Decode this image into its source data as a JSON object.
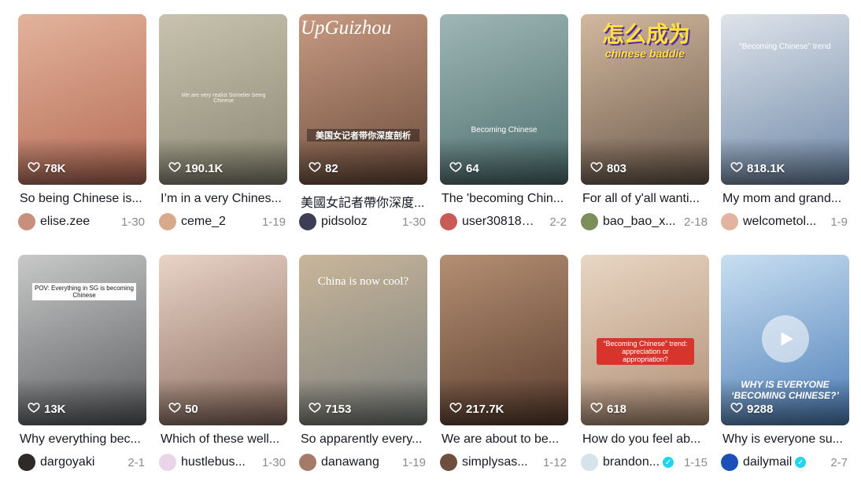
{
  "cards": [
    {
      "likes": "78K",
      "caption": "So being Chinese is...",
      "username": "elise.zee",
      "date": "1-30",
      "overlay": "",
      "bg": "#b46a55",
      "bg2": "#e3b39b",
      "avatar": "#c98f7d",
      "verified": false
    },
    {
      "likes": "190.1K",
      "caption": "I’m in a very Chines...",
      "username": "ceme_2",
      "date": "1-19",
      "overlay": "We are very realist Somelier being Chinese",
      "bg": "#8a8774",
      "bg2": "#c9c3ae",
      "avatar": "#d9a98c",
      "verified": false
    },
    {
      "likes": "82",
      "caption": "美國女記者帶你深度...",
      "username": "pidsoloz",
      "date": "1-30",
      "overlay": "UpGuizhou",
      "sub": "美国女记者带你深度剖析",
      "bg": "#6b4c3b",
      "bg2": "#c79a82",
      "avatar": "#3d3d56",
      "verified": false
    },
    {
      "likes": "64",
      "caption": "The 'becoming Chin...",
      "username": "user308181...",
      "date": "2-2",
      "overlay": "Becoming Chinese",
      "bg": "#4d6e6f",
      "bg2": "#9fb7b5",
      "avatar": "#c85b56",
      "verified": false
    },
    {
      "likes": "803",
      "caption": "For all of y'all wanti...",
      "username": "bao_bao_x...",
      "date": "2-18",
      "overlay": "怎么成为",
      "sub": "chinese baddie",
      "bg": "#6c5a4c",
      "bg2": "#d2b89e",
      "avatar": "#7c8e5a",
      "verified": false
    },
    {
      "likes": "818.1K",
      "caption": "My mom and grand...",
      "username": "welcometol...",
      "date": "1-9",
      "overlay": "“Becoming Chinese” trend",
      "bg": "#6e88a8",
      "bg2": "#dfe4ea",
      "avatar": "#e2b4a0",
      "verified": false
    },
    {
      "likes": "13K",
      "caption": "Why everything bec...",
      "username": "dargoyaki",
      "date": "2-1",
      "overlay": "POV: Everything in SG is becoming Chinese",
      "bg": "#5b5d60",
      "bg2": "#c8c9c8",
      "avatar": "#2d2a27",
      "verified": false
    },
    {
      "likes": "50",
      "caption": "Which of these well...",
      "username": "hustlebus...",
      "date": "1-30",
      "overlay": "",
      "bg": "#8a6c5e",
      "bg2": "#e9d4c7",
      "avatar": "#e8d5e8",
      "verified": false
    },
    {
      "likes": "7153",
      "caption": "So apparently every...",
      "username": "danawang",
      "date": "1-19",
      "overlay": "China is now cool?",
      "bg": "#7a7f7c",
      "bg2": "#c9b69b",
      "avatar": "#a57a6a",
      "verified": false
    },
    {
      "likes": "217.7K",
      "caption": "We are about to be...",
      "username": "simplysas...",
      "date": "1-12",
      "overlay": "",
      "bg": "#5a3d2e",
      "bg2": "#b58f73",
      "avatar": "#6d4e3f",
      "verified": false
    },
    {
      "likes": "618",
      "caption": "How do you feel ab...",
      "username": "brandon...",
      "date": "1-15",
      "overlay": "“Becoming Chinese” trend: appreciation or appropriation?",
      "bg": "#b08e75",
      "bg2": "#e8d6c3",
      "avatar": "#d6e3ea",
      "verified": true
    },
    {
      "likes": "9288",
      "caption": "Why is everyone su...",
      "username": "dailymail",
      "date": "2-7",
      "overlay": "WHY IS EVERYONE ‘BECOMING CHINESE?’",
      "bg": "#4e7fb9",
      "bg2": "#c9dff1",
      "avatar": "#1c4fb8",
      "verified": true
    }
  ]
}
